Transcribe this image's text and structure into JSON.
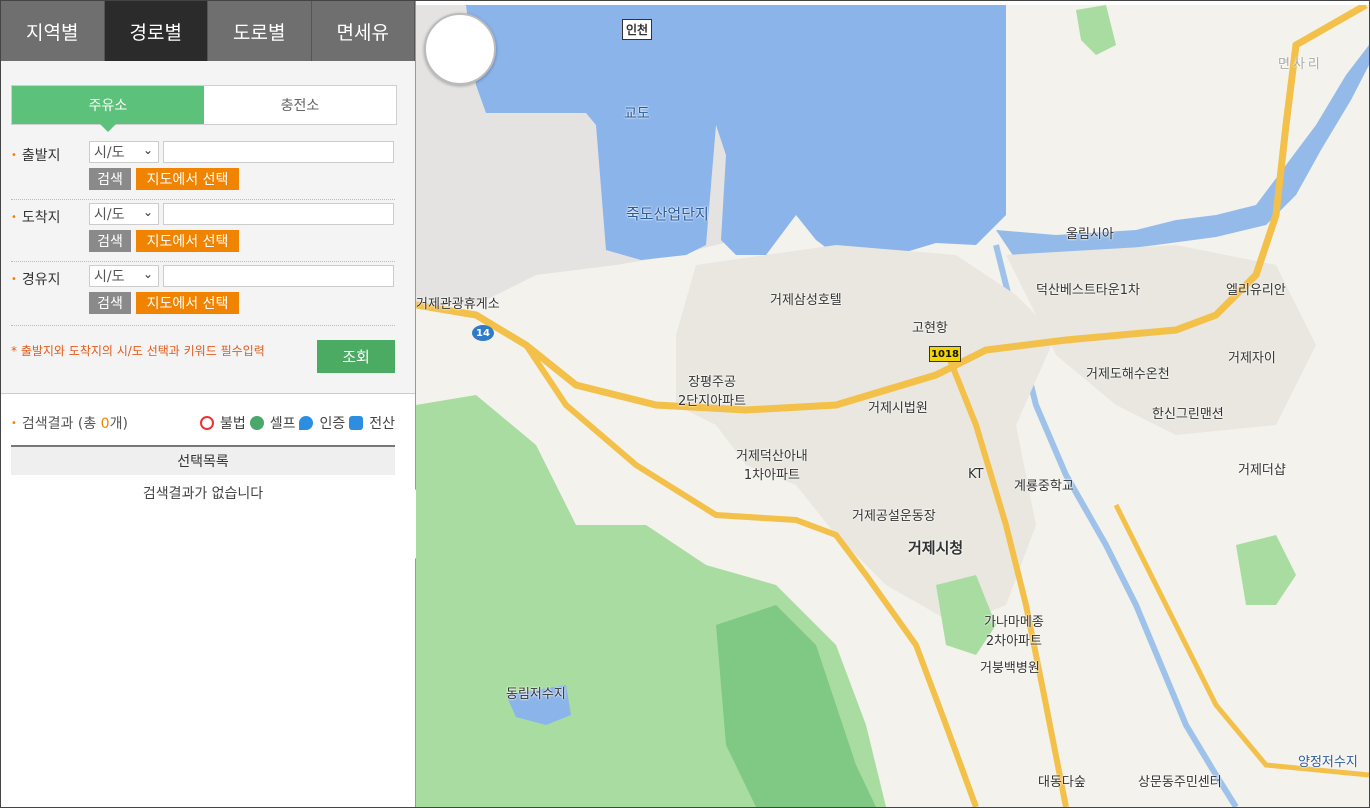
{
  "tabs": [
    "지역별",
    "경로별",
    "도로별",
    "면세유"
  ],
  "active_tab": 1,
  "subtabs": [
    "주유소",
    "충전소"
  ],
  "form": {
    "rows": [
      {
        "label": "출발지",
        "select": "시/도",
        "search": "검색",
        "map_select": "지도에서 선택"
      },
      {
        "label": "도착지",
        "select": "시/도",
        "search": "검색",
        "map_select": "지도에서 선택"
      },
      {
        "label": "경유지",
        "select": "시/도",
        "search": "검색",
        "map_select": "지도에서 선택"
      }
    ],
    "note": "* 출발지와 도착지의 시/도 선택과 키워드 필수입력",
    "submit": "조회"
  },
  "results": {
    "prefix": "검색결과 (총 ",
    "count": "0",
    "suffix": "개)",
    "legend": [
      "불법",
      "셀프",
      "인증",
      "전산"
    ],
    "list_header": "선택목록",
    "empty": "검색결과가 없습니다"
  },
  "map": {
    "labels": {
      "incheon": "인천",
      "gyodo": "교도",
      "jukdo": "죽도산업단지",
      "rest_area": "거제관광휴게소",
      "samsung_hotel": "거제삼성호텔",
      "gohyeon_port": "고현항",
      "wulrim": "울림시아",
      "deoksan_best": "덕산베스트타운1차",
      "elliyurian": "엘리유리안",
      "geojeai": "거제자이",
      "hot_spring": "거제도해수온천",
      "hansin": "한신그린맨션",
      "geojethesharp": "거제더샵",
      "jangpyeong": "장평주공\n2단지아파트",
      "court": "거제시법원",
      "deoksan_anae": "거제덕산아내\n1차아파트",
      "kt": "KT",
      "gyeryong": "계룡중학교",
      "stadium": "거제공설운동장",
      "city_hall": "거제시청",
      "ganama": "가나마메종\n2차아파트",
      "hospital": "거붕백병원",
      "donglim": "동림저수지",
      "daedong": "대동다숲",
      "sangmun": "상문동주민센터",
      "yangjeong": "양정저수지",
      "myeonsari": "면사리"
    },
    "route_badges": [
      "14",
      "1018"
    ],
    "colors": {
      "sea": "#8ab4ea",
      "green": "#a8dca0",
      "green_dark": "#7fc985",
      "road": "#f3c04a",
      "urban": "#e8e6df",
      "land": "#f4f3ee"
    }
  }
}
